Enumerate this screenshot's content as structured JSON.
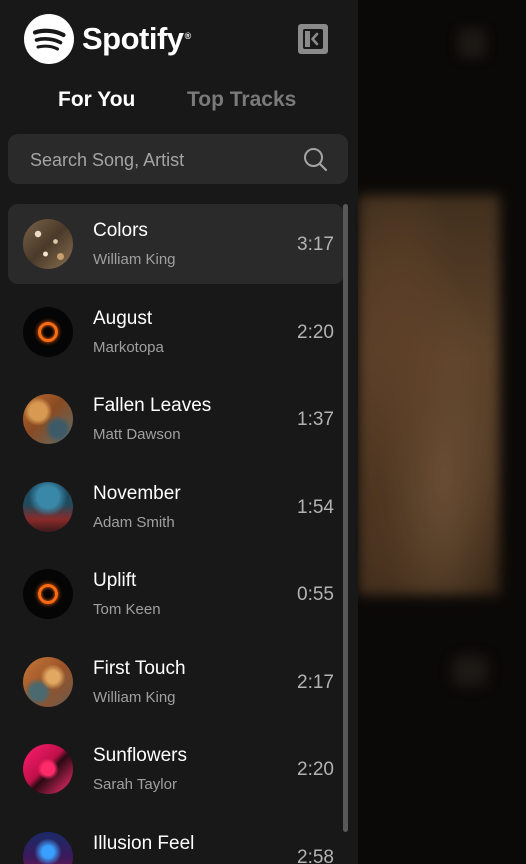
{
  "app": {
    "brand": "Spotify"
  },
  "tabs": [
    {
      "label": "For You",
      "active": true
    },
    {
      "label": "Top Tracks",
      "active": false
    }
  ],
  "search": {
    "placeholder": "Search Song, Artist",
    "value": ""
  },
  "tracks": [
    {
      "title": "Colors",
      "artist": "William King",
      "duration": "3:17",
      "cover": "colors-cover",
      "selected": true
    },
    {
      "title": "August",
      "artist": "Markotopa",
      "duration": "2:20",
      "cover": "orange-ring-cover"
    },
    {
      "title": "Fallen Leaves",
      "artist": "Matt Dawson",
      "duration": "1:37",
      "cover": "autumn-cover"
    },
    {
      "title": "November",
      "artist": "Adam Smith",
      "duration": "1:54",
      "cover": "blue-red-cover"
    },
    {
      "title": "Uplift",
      "artist": "Tom Keen",
      "duration": "0:55",
      "cover": "orange-ring-cover"
    },
    {
      "title": "First Touch",
      "artist": "William King",
      "duration": "2:17",
      "cover": "autumn-cover"
    },
    {
      "title": "Sunflowers",
      "artist": "Sarah Taylor",
      "duration": "2:20",
      "cover": "neon-pink-cover"
    },
    {
      "title": "Illusion Feel",
      "artist": "",
      "duration": "2:58",
      "cover": "neon-blue-cover"
    }
  ],
  "colors": {
    "sidebar_bg": "#181818",
    "selected_row_bg": "#2a2a2a",
    "brand_green": "#ffffff",
    "accent_orange": "#ff6a12"
  }
}
